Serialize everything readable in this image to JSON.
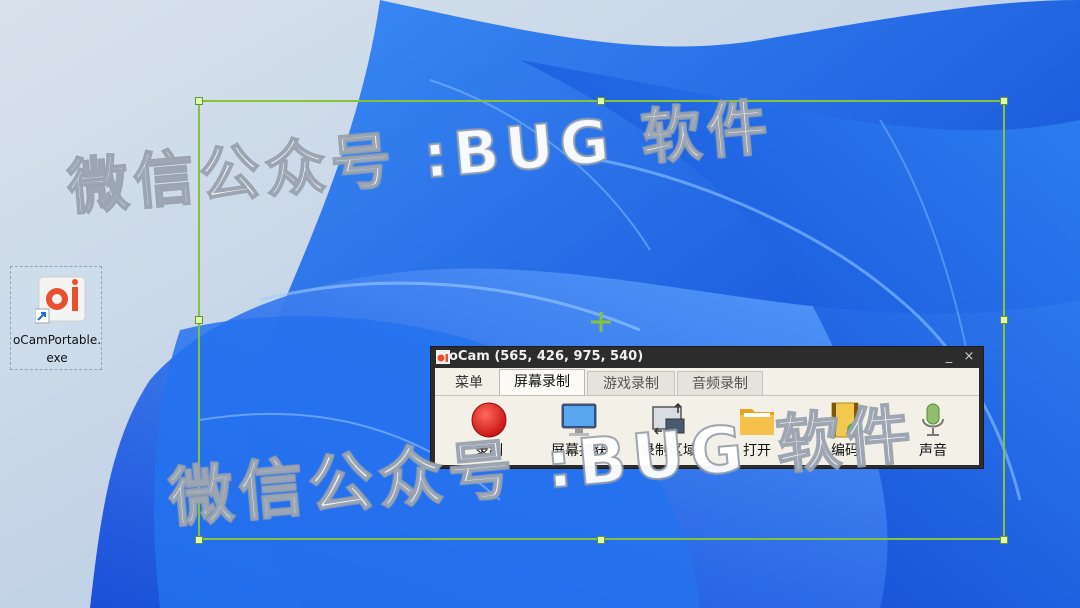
{
  "desktop": {
    "icon": {
      "label": "oCamPortable.exe",
      "icon": "ocam-app-icon"
    }
  },
  "watermark": {
    "line1": "微信公众号 :BUG 软件",
    "line2": "微信公众号 :BUG 软件"
  },
  "ocam": {
    "title": "oCam (565, 426, 975, 540)",
    "minimize": "_",
    "close": "×",
    "tabs": [
      {
        "label": "菜单",
        "state": "plain"
      },
      {
        "label": "屏幕录制",
        "state": "active"
      },
      {
        "label": "游戏录制",
        "state": "inactive"
      },
      {
        "label": "音频录制",
        "state": "inactive"
      }
    ],
    "tools": [
      {
        "label": "录制",
        "icon": "record-icon"
      },
      {
        "label": "屏幕捕获",
        "icon": "monitor-icon"
      },
      {
        "label": "录制区域",
        "icon": "region-icon"
      },
      {
        "label": "打开",
        "icon": "folder-icon"
      },
      {
        "label": "编码",
        "icon": "film-icon"
      },
      {
        "label": "声音",
        "icon": "microphone-icon"
      }
    ]
  },
  "colors": {
    "selection_frame": "#86c33b",
    "wallpaper_blue": "#1e5fe0",
    "wallpaper_bg": "#c9d7e6"
  }
}
